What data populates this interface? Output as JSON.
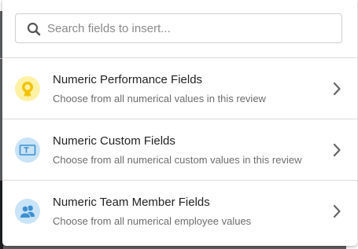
{
  "search": {
    "placeholder": "Search fields to insert...",
    "value": "",
    "icon": "search-icon"
  },
  "items": [
    {
      "title": "Numeric Performance Fields",
      "description": "Choose from all numerical values in this review",
      "icon": "award-ribbon-icon",
      "icon_bg": "#fdf1a6",
      "icon_color": "#f2c300"
    },
    {
      "title": "Numeric Custom Fields",
      "description": "Choose from all numerical custom values in this review",
      "icon": "text-field-icon",
      "icon_bg": "#c9e3f7",
      "icon_color": "#3c8fd0"
    },
    {
      "title": "Numeric Team Member Fields",
      "description": "Choose from all numerical employee values",
      "icon": "team-members-icon",
      "icon_bg": "#c9e3f7",
      "icon_color": "#3c8fd0"
    }
  ],
  "colors": {
    "chevron": "#666666",
    "divider": "#dcdcdc",
    "overlay": "#5f6163"
  }
}
